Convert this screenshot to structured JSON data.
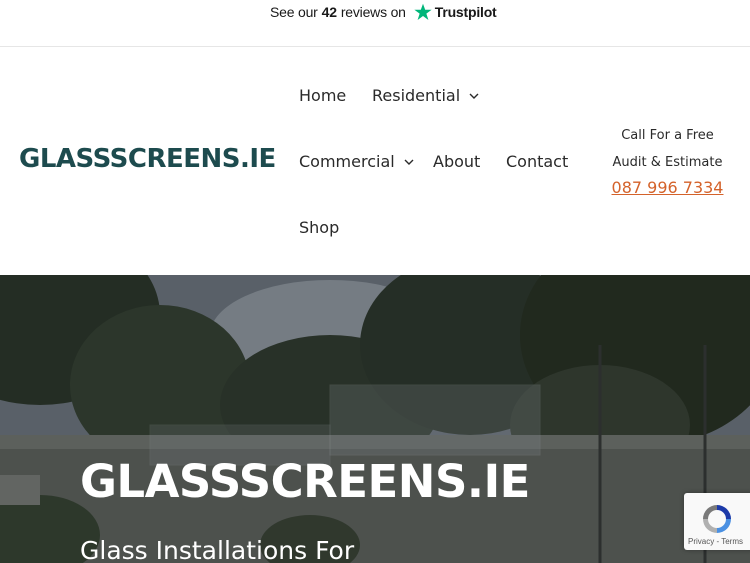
{
  "trustpilot": {
    "prefix": "See our",
    "count": "42",
    "suffix": "reviews on",
    "brand": "Trustpilot",
    "star_color": "#00b67a",
    "icon": "trustpilot-star-icon"
  },
  "header": {
    "logo": "GLASSSCREENS.IE",
    "logo_color": "#1d4b4e"
  },
  "nav": {
    "home": "Home",
    "residential": "Residential",
    "commercial": "Commercial",
    "about": "About",
    "contact": "Contact",
    "shop": "Shop",
    "dropdown_icon": "chevron-down-icon"
  },
  "cta": {
    "line1": "Call For a Free",
    "line2": "Audit & Estimate",
    "phone": "087 996 7334",
    "phone_color": "#d4622a"
  },
  "hero": {
    "title": "GLASSSCREENS.IE",
    "subtitle": "Glass Installations For"
  },
  "recaptcha": {
    "privacy": "Privacy",
    "separator": "-",
    "terms": "Terms",
    "icon": "recaptcha-logo-icon"
  }
}
